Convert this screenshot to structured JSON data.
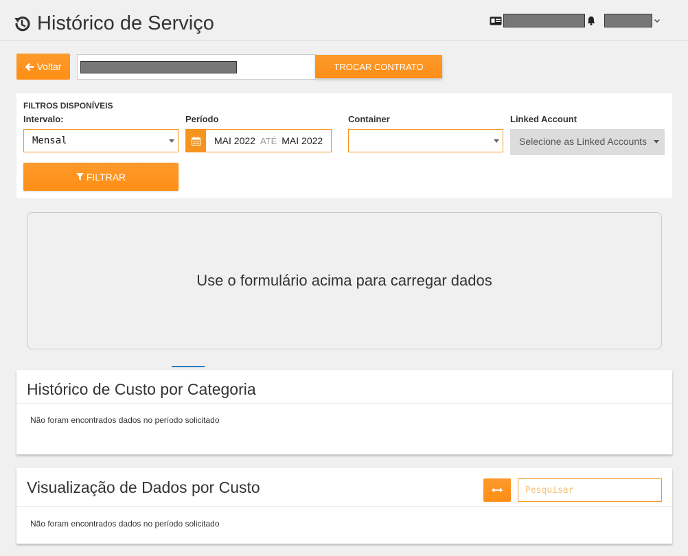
{
  "header": {
    "title": "Histórico de Serviço",
    "icons": [
      "history-icon",
      "id-card-icon",
      "bell-icon",
      "chevron-down-icon"
    ]
  },
  "toolbar": {
    "back_label": "Voltar",
    "swap_contract_label": "TROCAR CONTRATO"
  },
  "filters": {
    "title": "FILTROS DISPONÍVEIS",
    "interval_label": "Intervalo:",
    "interval_value": "Mensal",
    "period_label": "Período",
    "period_start": "MAI 2022",
    "period_separator": "ATÉ",
    "period_end": "MAI 2022",
    "container_label": "Container",
    "container_value": "",
    "linked_account_label": "Linked Account",
    "linked_account_placeholder": "Selecione as Linked Accounts",
    "filter_button_label": "FILTRAR"
  },
  "main": {
    "empty_message": "Use o formulário acima para carregar dados"
  },
  "cards": {
    "category_history": {
      "title": "Histórico de Custo por Categoria",
      "message": "Não foram encontrados dados no período solicitado"
    },
    "cost_view": {
      "title": "Visualização de Dados por Custo",
      "message": "Não foram encontrados dados no período solicitado",
      "search_placeholder": "Pesquisar"
    }
  },
  "colors": {
    "accent": "#f7941d",
    "background": "#f0f0f0",
    "text": "#333333"
  }
}
